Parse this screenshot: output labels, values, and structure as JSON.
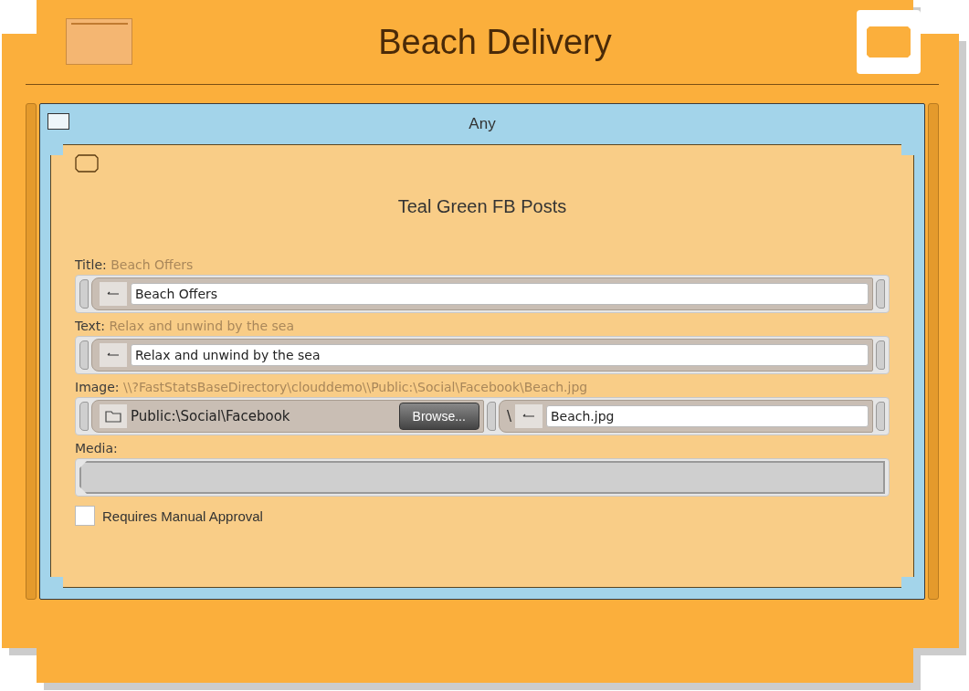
{
  "header": {
    "title": "Beach Delivery"
  },
  "group": {
    "label": "Any"
  },
  "card": {
    "title": "Teal Green FB Posts",
    "fields": [
      {
        "kind": "text",
        "label": "Title:",
        "preview": "Beach Offers",
        "value": "Beach Offers"
      },
      {
        "kind": "text",
        "label": "Text:",
        "preview": "Relax and unwind by the sea",
        "value": "Relax and unwind by the sea"
      },
      {
        "kind": "file",
        "label": "Image:",
        "preview": "\\\\?FastStatsBaseDirectory\\clouddemo\\\\Public:\\Social\\Facebook\\Beach.jpg",
        "folder": "Public:\\Social\\Facebook",
        "button": "Browse...",
        "separator": "\\",
        "value": "Beach.jpg"
      },
      {
        "kind": "media",
        "label": "Media:"
      }
    ],
    "approval": {
      "label": "Requires Manual Approval",
      "checked": false
    }
  }
}
